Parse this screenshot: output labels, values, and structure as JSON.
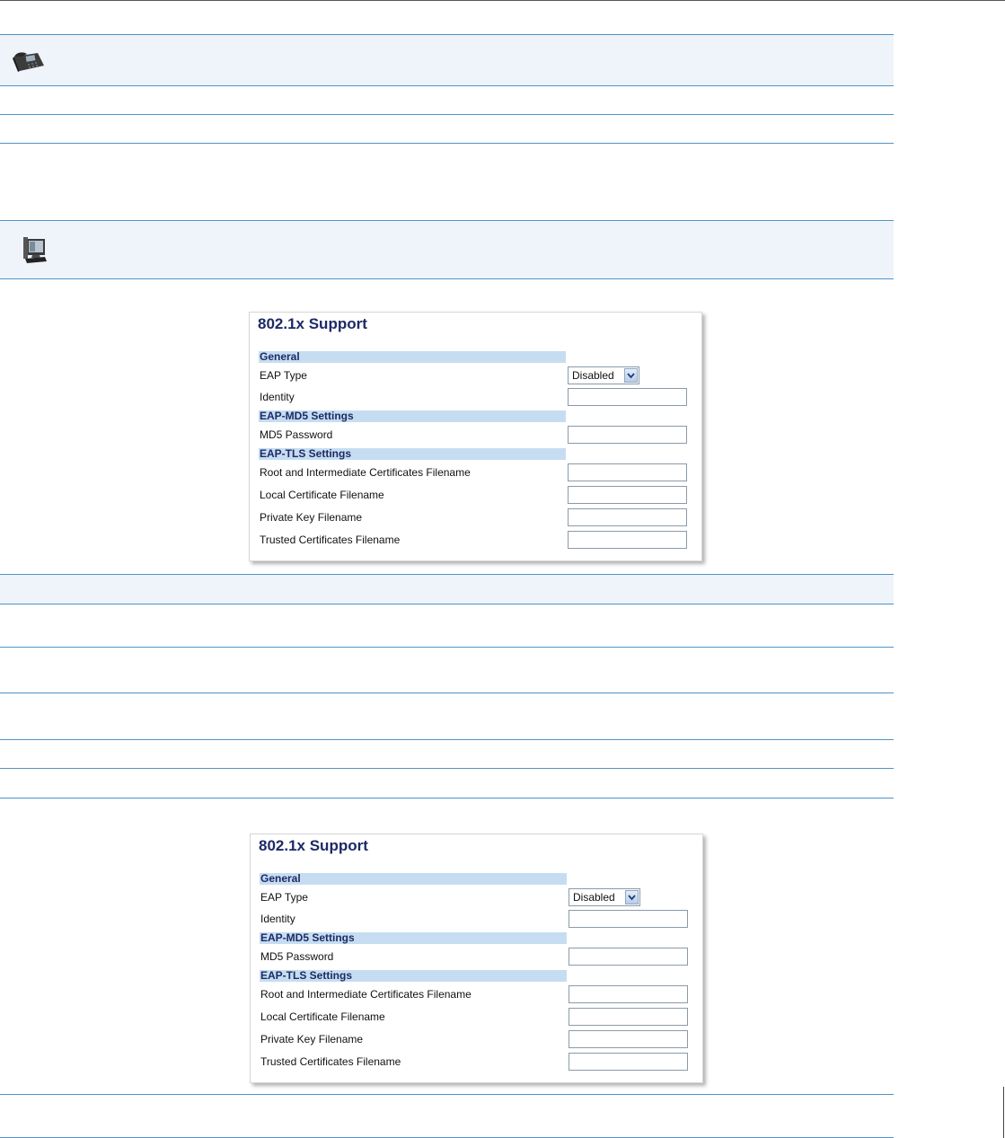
{
  "settings_panels": [
    {
      "title": "802.1x Support",
      "sections": {
        "general": "General",
        "md5": "EAP-MD5 Settings",
        "tls": "EAP-TLS Settings"
      },
      "fields": {
        "eap_type": {
          "label": "EAP Type",
          "value": "Disabled"
        },
        "identity": {
          "label": "Identity",
          "value": ""
        },
        "md5_password": {
          "label": "MD5 Password",
          "value": ""
        },
        "root_cert": {
          "label": "Root and Intermediate Certificates Filename",
          "value": ""
        },
        "local_cert": {
          "label": "Local Certificate Filename",
          "value": ""
        },
        "private_key": {
          "label": "Private Key Filename",
          "value": ""
        },
        "trusted_certs": {
          "label": "Trusted Certificates Filename",
          "value": ""
        }
      }
    },
    {
      "title": "802.1x Support",
      "sections": {
        "general": "General",
        "md5": "EAP-MD5 Settings",
        "tls": "EAP-TLS Settings"
      },
      "fields": {
        "eap_type": {
          "label": "EAP Type",
          "value": "Disabled"
        },
        "identity": {
          "label": "Identity",
          "value": ""
        },
        "md5_password": {
          "label": "MD5 Password",
          "value": ""
        },
        "root_cert": {
          "label": "Root and Intermediate Certificates Filename",
          "value": ""
        },
        "local_cert": {
          "label": "Local Certificate Filename",
          "value": ""
        },
        "private_key": {
          "label": "Private Key Filename",
          "value": ""
        },
        "trusted_certs": {
          "label": "Trusted Certificates Filename",
          "value": ""
        }
      }
    }
  ],
  "icons": {
    "phone_ui": "ip-phone-icon",
    "web_ui": "computer-icon"
  },
  "colors": {
    "rule": "#4f94c8",
    "band": "#eef4fa",
    "section_bar": "#c6ddf1",
    "title": "#1c2a66"
  }
}
